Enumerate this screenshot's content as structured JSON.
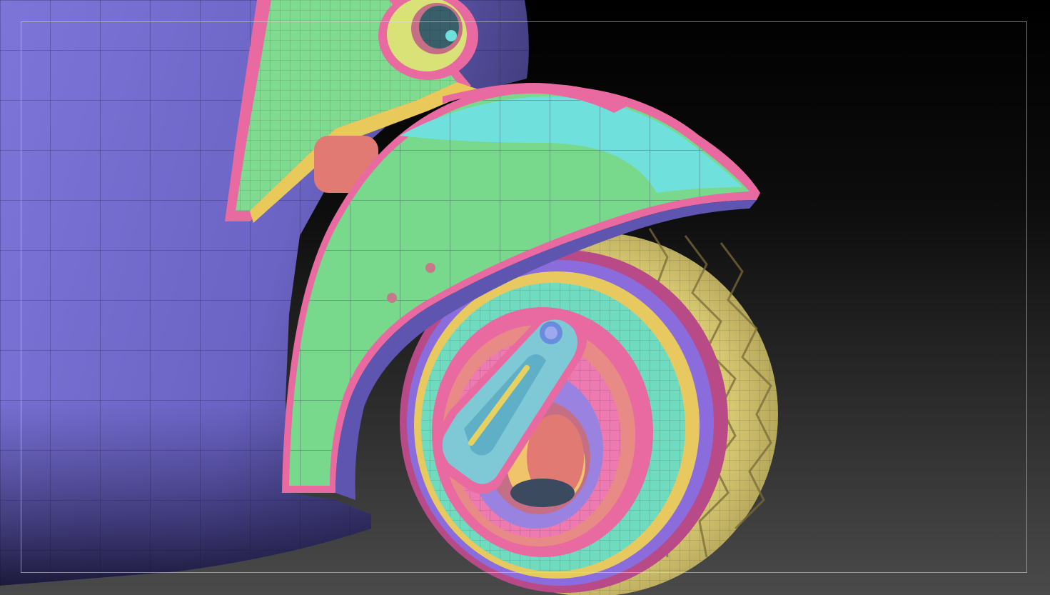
{
  "viewport": {
    "background_top": "#000000",
    "background_bottom": "#4a4a4a",
    "render_mode": "polygroups-wireframe"
  },
  "colors": {
    "body": "#6f67c8",
    "mudguard_green": "#78d98c",
    "mudguard_cyan": "#6fe0dc",
    "rim_pink": "#e96aa0",
    "tire": "#e6d57a",
    "hub_purple": "#9a82e0",
    "accent_orange": "#f39a78"
  },
  "framing_guide": true
}
